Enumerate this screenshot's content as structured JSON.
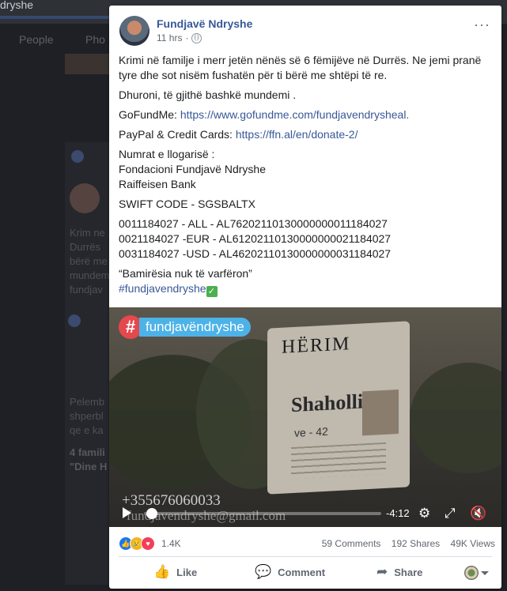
{
  "background": {
    "top_title": "dryshe",
    "tabs": [
      "People",
      "Pho"
    ],
    "snippets": [
      "Krim ne",
      "Durrës",
      "bërë me",
      "mundem",
      "fundjav",
      "Pelemb",
      "shperbl",
      "qe e ka",
      "4 famili",
      "\"Dine H"
    ]
  },
  "post": {
    "author": "Fundjavë Ndryshe",
    "time": "11 hrs",
    "more": "···",
    "paragraphs": {
      "p1": "Krimi në familje i merr jetën nënës së 6 fëmijëve në Durrës. Ne jemi pranë tyre dhe sot nisëm fushatën për ti bërë me shtëpi të re.",
      "p2": "Dhuroni, të gjithë bashkë mundemi .",
      "gofund_label": "GoFundMe: ",
      "gofund_link": "https://www.gofundme.com/fundjavendrysheal.",
      "paypal_label": "PayPal & Credit Cards: ",
      "paypal_link": "https://ffn.al/en/donate-2/",
      "acc_header": "Numrat e llogarisë :",
      "acc_foundation": "Fondacioni Fundjavë Ndryshe",
      "acc_bank": "Raiffeisen Bank",
      "swift": "SWIFT CODE - SGSBALTX",
      "acc_all": "0011184027 - ALL - AL76202110130000000011184027",
      "acc_eur": "0021184027 -EUR - AL61202110130000000021184027",
      "acc_usd": "0031184027 -USD - AL46202110130000000031184027",
      "quote": "“Bamirësia nuk të varfëron”",
      "hashtag": "#fundjavendryshe",
      "check": "✓"
    },
    "video": {
      "logo_hash": "#",
      "logo_text": "fundjavëndryshe",
      "poster_title": "HËRIM",
      "poster_name": "Shaholli",
      "poster_num": "ve - 42",
      "phone": "+355676060033",
      "email": "fundjavendryshe@gmail.com",
      "time_left": "-4:12",
      "progress": 0.01
    },
    "stats": {
      "reactions_count": "1.4K",
      "comments": "59 Comments",
      "shares": "192 Shares",
      "views": "49K Views"
    },
    "actions": {
      "like": "Like",
      "comment": "Comment",
      "share": "Share"
    }
  }
}
